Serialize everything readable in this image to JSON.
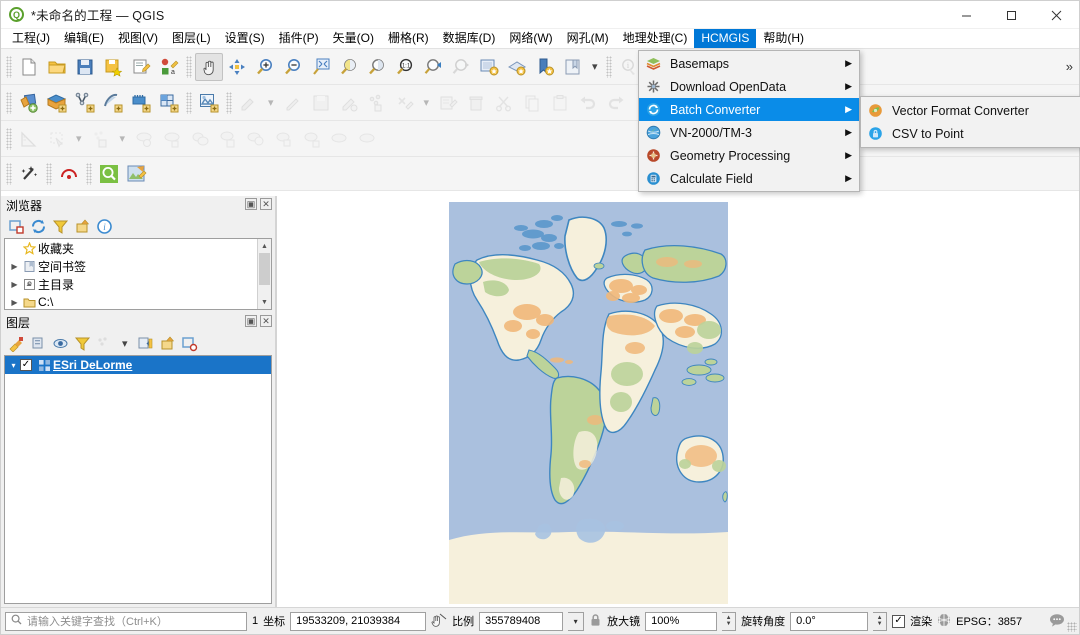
{
  "window": {
    "title": "*未命名的工程 — QGIS",
    "logo": "qgis-logo",
    "minimize": "—",
    "maximize": "▢",
    "close": "✕"
  },
  "menubar": {
    "items": [
      {
        "label": "工程(J)",
        "id": "project"
      },
      {
        "label": "编辑(E)",
        "id": "edit"
      },
      {
        "label": "视图(V)",
        "id": "view"
      },
      {
        "label": "图层(L)",
        "id": "layer"
      },
      {
        "label": "设置(S)",
        "id": "settings"
      },
      {
        "label": "插件(P)",
        "id": "plugins"
      },
      {
        "label": "矢量(O)",
        "id": "vector"
      },
      {
        "label": "栅格(R)",
        "id": "raster"
      },
      {
        "label": "数据库(D)",
        "id": "database"
      },
      {
        "label": "网络(W)",
        "id": "web"
      },
      {
        "label": "网孔(M)",
        "id": "mesh"
      },
      {
        "label": "地理处理(C)",
        "id": "processing"
      },
      {
        "label": "HCMGIS",
        "id": "hcmgis",
        "active": true
      },
      {
        "label": "帮助(H)",
        "id": "help"
      }
    ]
  },
  "hcmgis_menu": {
    "items": [
      {
        "label": "Basemaps",
        "icon": "layers-icon",
        "submenu": true,
        "highlighted": false
      },
      {
        "label": "Download OpenData",
        "icon": "asterisk-icon",
        "submenu": true,
        "highlighted": false
      },
      {
        "label": "Batch Converter",
        "icon": "refresh-icon",
        "submenu": true,
        "highlighted": true
      },
      {
        "label": "VN-2000/TM-3",
        "icon": "globe-icon",
        "submenu": true,
        "highlighted": false
      },
      {
        "label": "Geometry Processing",
        "icon": "gear-red-icon",
        "submenu": true,
        "highlighted": false
      },
      {
        "label": "Calculate Field",
        "icon": "calculator-icon",
        "submenu": true,
        "highlighted": false
      }
    ]
  },
  "batch_converter_submenu": {
    "items": [
      {
        "label": "Vector Format Converter",
        "icon": "vector-convert-icon"
      },
      {
        "label": "CSV to Point",
        "icon": "csv-point-icon"
      }
    ]
  },
  "toolbars": {
    "row1": [
      {
        "name": "new-project-icon",
        "disabled": false
      },
      {
        "name": "open-project-icon",
        "disabled": false
      },
      {
        "name": "save-project-icon",
        "disabled": false
      },
      {
        "name": "save-project-as-icon",
        "disabled": false
      },
      {
        "name": "new-print-layout-icon",
        "disabled": false
      },
      {
        "name": "style-manager-icon",
        "disabled": false
      },
      {
        "name": "pan-map-icon",
        "selected": true
      },
      {
        "name": "pan-to-selection-icon",
        "disabled": false
      },
      {
        "name": "zoom-in-icon",
        "disabled": false
      },
      {
        "name": "zoom-out-icon",
        "disabled": false
      },
      {
        "name": "zoom-full-icon",
        "disabled": false
      },
      {
        "name": "zoom-selection-icon",
        "disabled": false
      },
      {
        "name": "zoom-layer-icon",
        "disabled": false
      },
      {
        "name": "zoom-native-icon",
        "disabled": false
      },
      {
        "name": "zoom-last-icon",
        "disabled": false
      },
      {
        "name": "zoom-next-icon",
        "disabled": true
      },
      {
        "name": "new-map-view-icon",
        "disabled": false
      },
      {
        "name": "new-3d-map-view-icon",
        "disabled": false
      },
      {
        "name": "new-bookmark-icon",
        "disabled": false
      },
      {
        "name": "show-bookmarks-icon",
        "disabled": false
      },
      {
        "name": "refresh-map-icon",
        "disabled": false
      },
      {
        "name": "identify-features-icon",
        "disabled": true
      },
      {
        "name": "attribute-table-icon",
        "disabled": false
      },
      {
        "name": "processing-toolbox-icon",
        "disabled": false
      }
    ],
    "row2": [
      {
        "name": "open-data-source-manager-icon"
      },
      {
        "name": "add-vector-layer-icon"
      },
      {
        "name": "add-raster-layer-icon"
      },
      {
        "name": "add-mesh-layer-icon"
      },
      {
        "name": "add-delimited-text-layer-icon"
      },
      {
        "name": "add-postgis-layer-icon"
      },
      {
        "name": "add-spatialite-layer-icon"
      },
      {
        "name": "add-wms-layer-icon"
      },
      {
        "name": "current-edits-icon",
        "disabled": true
      },
      {
        "name": "toggle-editing-icon",
        "disabled": true
      },
      {
        "name": "save-layer-edits-icon",
        "disabled": true
      },
      {
        "name": "add-feature-icon",
        "disabled": true
      },
      {
        "name": "vertex-tool-icon",
        "disabled": true
      },
      {
        "name": "modify-attributes-icon",
        "disabled": true
      },
      {
        "name": "delete-selected-icon",
        "disabled": true
      },
      {
        "name": "cut-features-icon",
        "disabled": true
      },
      {
        "name": "copy-features-icon",
        "disabled": true
      },
      {
        "name": "paste-features-icon",
        "disabled": true
      },
      {
        "name": "undo-icon",
        "disabled": true
      },
      {
        "name": "redo-icon",
        "disabled": true
      }
    ],
    "row3": [
      {
        "name": "measure-line-icon",
        "disabled": true
      },
      {
        "name": "select-features-icon",
        "disabled": true
      },
      {
        "name": "select-by-value-icon",
        "disabled": true
      },
      {
        "name": "deselect-features-icon",
        "disabled": true
      },
      {
        "name": "open-field-calculator-icon",
        "disabled": true
      },
      {
        "name": "show-statistics-icon",
        "disabled": true
      },
      {
        "name": "map-tips-icon",
        "disabled": true
      },
      {
        "name": "text-annotation-icon",
        "disabled": true
      },
      {
        "name": "html-annotation-icon",
        "disabled": true
      },
      {
        "name": "svg-annotation-icon",
        "disabled": true
      },
      {
        "name": "form-annotation-icon",
        "disabled": true
      },
      {
        "name": "move-annotation-icon",
        "disabled": true
      },
      {
        "name": "temporal-controller-icon",
        "disabled": true
      },
      {
        "name": "python-console-icon",
        "disabled": true
      }
    ],
    "row4": [
      {
        "name": "magic-wand-icon"
      },
      {
        "name": "georeferencer-icon"
      },
      {
        "name": "metasearch-icon"
      },
      {
        "name": "plugin-toolbox-icon"
      }
    ],
    "overflow": "»"
  },
  "browser_panel": {
    "title": "浏览器",
    "float_btn": "▣",
    "close_btn": "✕",
    "tools": [
      {
        "name": "add-selected-layers-icon"
      },
      {
        "name": "refresh-icon"
      },
      {
        "name": "filter-browser-icon"
      },
      {
        "name": "collapse-all-icon"
      },
      {
        "name": "properties-icon"
      }
    ],
    "items": [
      {
        "label": "收藏夹",
        "icon": "star-icon",
        "expandable": false
      },
      {
        "label": "空间书签",
        "icon": "bookmark-icon",
        "expandable": true
      },
      {
        "label": "主目录",
        "icon": "home-icon",
        "expandable": true
      },
      {
        "label": "C:\\",
        "icon": "folder-icon",
        "expandable": true
      }
    ]
  },
  "layers_panel": {
    "title": "图层",
    "float_btn": "▣",
    "close_btn": "✕",
    "tools": [
      {
        "name": "open-layer-styling-icon"
      },
      {
        "name": "add-group-icon"
      },
      {
        "name": "manage-map-themes-icon"
      },
      {
        "name": "filter-legend-icon"
      },
      {
        "name": "filter-legend-expression-icon"
      },
      {
        "name": "expand-all-icon"
      },
      {
        "name": "collapse-all-icon"
      },
      {
        "name": "remove-layer-icon"
      }
    ],
    "layers": [
      {
        "name": "ESri DeLorme",
        "checked": true,
        "selected": true,
        "icon": "raster-layer-icon"
      }
    ]
  },
  "statusbar": {
    "locator_placeholder": "请输入关键字查找（Ctrl+K）",
    "locator_icon": "search-icon",
    "ready_count": "1",
    "coord_label": "坐标",
    "coord_value": "19533209, 21039384",
    "toggle_extents_icon": "toggle-extents-icon",
    "scale_label": "比例",
    "scale_value": "355789408",
    "lock_icon": "lock-icon",
    "magnifier_label": "放大镜",
    "magnifier_value": "100%",
    "rotation_label": "旋转角度",
    "rotation_value": "0.0°",
    "render_label": "渲染",
    "render_checked": true,
    "crs_icon": "crs-globe-icon",
    "crs_value": "EPSG：3857",
    "messages_icon": "message-log-icon"
  },
  "map": {
    "layer_name": "ESri DeLorme",
    "ocean_color": "#aac0de",
    "land_color": "#f6f0dc",
    "vegetation_color": "#bcd39a",
    "urban_color": "#f1b87a",
    "coast_color": "#3e86c0"
  }
}
